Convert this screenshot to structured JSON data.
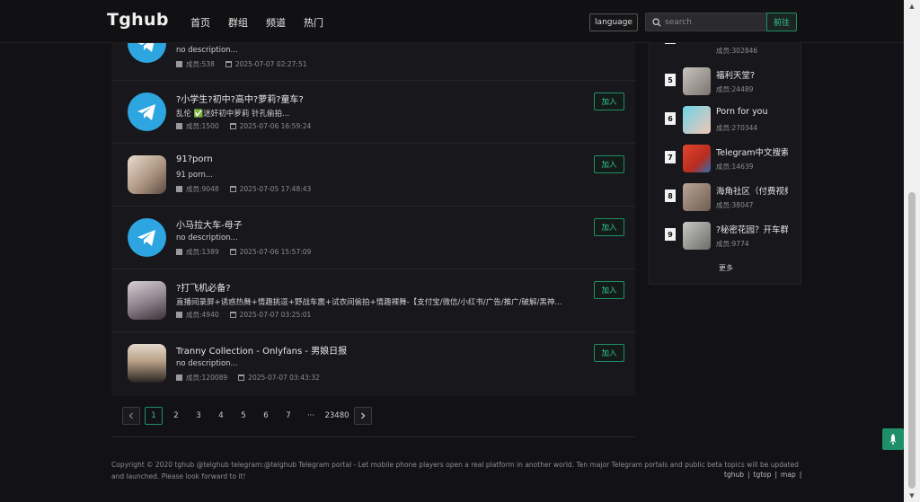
{
  "brand": "Tghub",
  "nav": [
    "首页",
    "群组",
    "频道",
    "热门"
  ],
  "language_label": "language",
  "search": {
    "placeholder": "search",
    "button": "前往"
  },
  "items": [
    {
      "title": "",
      "desc": "no description...",
      "members": "成员:538",
      "date": "2025-07-07 02:27:51",
      "join": "加入",
      "avatar": "telegram"
    },
    {
      "title": "?小学生?初中?高中?萝莉?童车?",
      "desc": "乱伦 ✅迷奸初中萝莉 针孔偷拍...",
      "members": "成员:1500",
      "date": "2025-07-06 16:59:24",
      "join": "加入",
      "avatar": "telegram"
    },
    {
      "title": "91?porn",
      "desc": "91 porn...",
      "members": "成员:9048",
      "date": "2025-07-05 17:48:43",
      "join": "加入",
      "avatar": "photo"
    },
    {
      "title": "小马拉大车-母子",
      "desc": "no description...",
      "members": "成员:1389",
      "date": "2025-07-06 15:57:09",
      "join": "加入",
      "avatar": "telegram"
    },
    {
      "title": "?打飞机必备?",
      "desc": "直播间录屏+诱惑热舞+情趣挑逗+野战车震+试衣间偷拍+情趣裸舞-【支付宝/微信/小红书/广告/推广/破解/黑神...",
      "members": "成员:4940",
      "date": "2025-07-07 03:25:01",
      "join": "加入",
      "avatar": "photo"
    },
    {
      "title": "Tranny Collection - Onlyfans - 男娘日报",
      "desc": "no description...",
      "members": "成员:120089",
      "date": "2025-07-07 03:43:32",
      "join": "加入",
      "avatar": "photo"
    }
  ],
  "pagination": {
    "pages": [
      "1",
      "2",
      "3",
      "4",
      "5",
      "6",
      "7"
    ],
    "ellipsis": "···",
    "last": "23480",
    "current": "1"
  },
  "sidebar": {
    "entries": [
      {
        "rank": "",
        "name": "",
        "count": "成员:302846"
      },
      {
        "rank": "5",
        "name": "福利天堂?",
        "count": "成员:24489"
      },
      {
        "rank": "6",
        "name": "Porn for you",
        "count": "成员:270344"
      },
      {
        "rank": "7",
        "name": "Telegram中文搜索",
        "count": "成员:14639"
      },
      {
        "rank": "8",
        "name": "海角社区（付费视频",
        "count": "成员:38047"
      },
      {
        "rank": "9",
        "name": "?秘密花园？开车群",
        "count": "成员:9774"
      }
    ],
    "more": "更多"
  },
  "footer": {
    "text": "Copyright © 2020 tghub   @telghub   telegram:@telghub Telegram portal - Let mobile phone players open a real platform in another world. Ten major Telegram portals and public beta topics will be updated and launched. Please look forward to it!",
    "links": [
      "tghub",
      "|",
      "tgtop",
      "|",
      "map",
      "|"
    ]
  },
  "colors": {
    "accent": "#38c995",
    "telegram": "#2ca5e0",
    "bg": "#121216",
    "panel": "#18181c"
  }
}
